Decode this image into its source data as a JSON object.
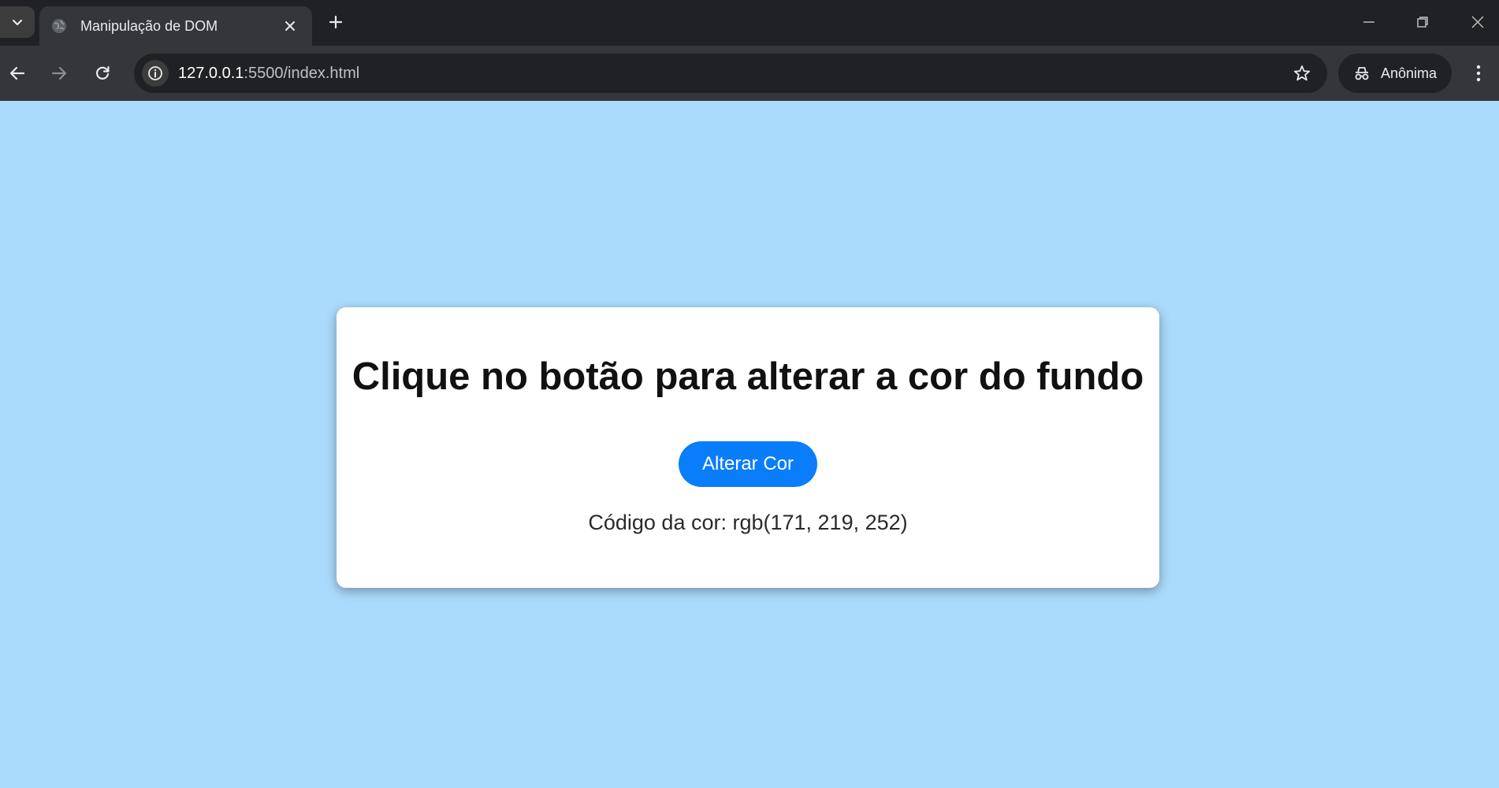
{
  "browser": {
    "tab_title": "Manipulação de DOM",
    "url_host": "127.0.0.1",
    "url_path": ":5500/index.html",
    "profile_label": "Anônima",
    "icons": {
      "tab_search": "chevron-down-icon",
      "favicon": "globe-icon",
      "tab_close": "close-icon",
      "new_tab": "plus-icon",
      "back": "arrow-left-icon",
      "forward": "arrow-right-icon",
      "reload": "reload-icon",
      "site_info": "info-icon",
      "bookmark": "star-icon",
      "incognito": "incognito-icon",
      "menu": "kebab-menu-icon",
      "minimize": "minimize-icon",
      "restore": "restore-icon",
      "close_window": "close-icon"
    }
  },
  "page": {
    "background_color": "#abdbfc",
    "title": "Clique no botão para alterar a cor do fundo",
    "button_label": "Alterar Cor",
    "color_code_text": "Código da cor: rgb(171, 219, 252)",
    "accent_color": "#0a7dfb"
  }
}
